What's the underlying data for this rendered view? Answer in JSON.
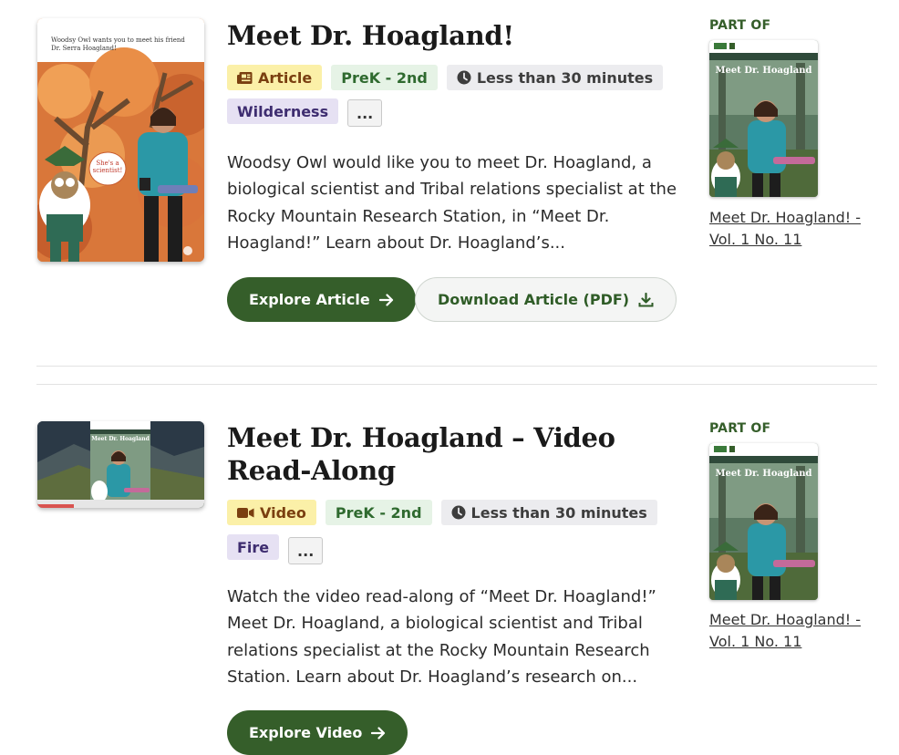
{
  "colors": {
    "primary": "#355e2a",
    "type_tag_bg": "#fbf0a8",
    "grade_tag_bg": "#e6f3e6",
    "time_tag_bg": "#ececef",
    "topic_tag_bg": "#e6e1f3"
  },
  "items": [
    {
      "title": "Meet Dr. Hoagland!",
      "type_label": "Article",
      "type_icon": "newspaper-icon",
      "grade": "PreK - 2nd",
      "time": "Less than 30 minutes",
      "topic": "Wilderness",
      "more": "...",
      "description": "Woodsy Owl would like you to meet Dr. Hoagland, a biological scientist and Tribal relations specialist at the Rocky Mountain Research Station, in “Meet Dr. Hoagland!” Learn about Dr. Hoagland’s...",
      "primary_button": "Explore Article",
      "secondary_button": "Download Article (PDF)",
      "thumb_caption": "Woodsy Owl wants you to meet his friend Dr. Serra Hoagland!",
      "thumb_bubble": "She's a scientist!",
      "part_of_label": "PART OF",
      "part_of_cover_title": "Meet Dr. Hoagland",
      "part_of_link": "Meet Dr. Hoagland! - Vol. 1 No. 11"
    },
    {
      "title": "Meet Dr. Hoagland – Video Read-Along",
      "type_label": "Video",
      "type_icon": "video-camera-icon",
      "grade": "PreK - 2nd",
      "time": "Less than 30 minutes",
      "topic": "Fire",
      "more": "...",
      "description": "Watch the video read-along of “Meet Dr. Hoagland!” Meet Dr. Hoagland, a biological scientist and Tribal relations specialist at the Rocky Mountain Research Station. Learn about Dr. Hoagland’s research on...",
      "primary_button": "Explore Video",
      "thumb_title": "Meet Dr. Hoagland",
      "part_of_label": "PART OF",
      "part_of_cover_title": "Meet Dr. Hoagland",
      "part_of_link": "Meet Dr. Hoagland! - Vol. 1 No. 11"
    }
  ]
}
